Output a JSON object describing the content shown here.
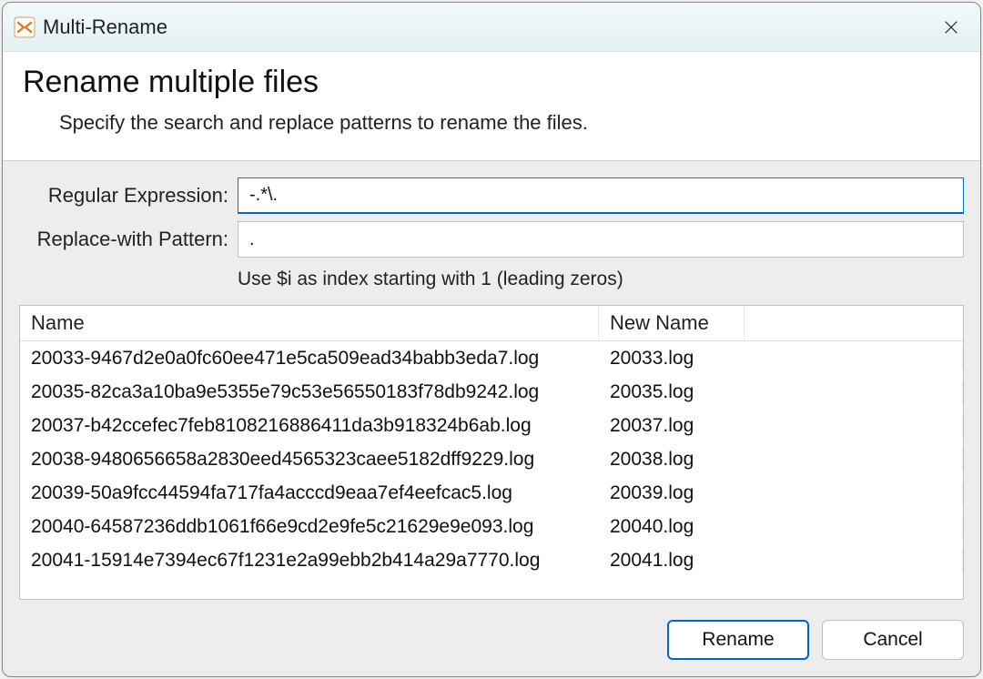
{
  "window": {
    "title": "Multi-Rename"
  },
  "header": {
    "heading": "Rename multiple files",
    "subtitle": "Specify the search and replace patterns to rename the files."
  },
  "fields": {
    "regex_label": "Regular Expression:",
    "regex_value": "-.*\\.",
    "replace_label": "Replace-with Pattern:",
    "replace_value": ".",
    "hint": "Use $i as index starting with 1 (leading zeros)"
  },
  "table": {
    "headers": {
      "name": "Name",
      "newname": "New Name"
    },
    "rows": [
      {
        "name": "20033-9467d2e0a0fc60ee471e5ca509ead34babb3eda7.log",
        "newname": "20033.log"
      },
      {
        "name": "20035-82ca3a10ba9e5355e79c53e56550183f78db9242.log",
        "newname": "20035.log"
      },
      {
        "name": "20037-b42ccefec7feb8108216886411da3b918324b6ab.log",
        "newname": "20037.log"
      },
      {
        "name": "20038-9480656658a2830eed4565323caee5182dff9229.log",
        "newname": "20038.log"
      },
      {
        "name": "20039-50a9fcc44594fa717fa4acccd9eaa7ef4eefcac5.log",
        "newname": "20039.log"
      },
      {
        "name": "20040-64587236ddb1061f66e9cd2e9fe5c21629e9e093.log",
        "newname": "20040.log"
      },
      {
        "name": "20041-15914e7394ec67f1231e2a99ebb2b414a29a7770.log",
        "newname": "20041.log"
      }
    ]
  },
  "buttons": {
    "rename": "Rename",
    "cancel": "Cancel"
  }
}
